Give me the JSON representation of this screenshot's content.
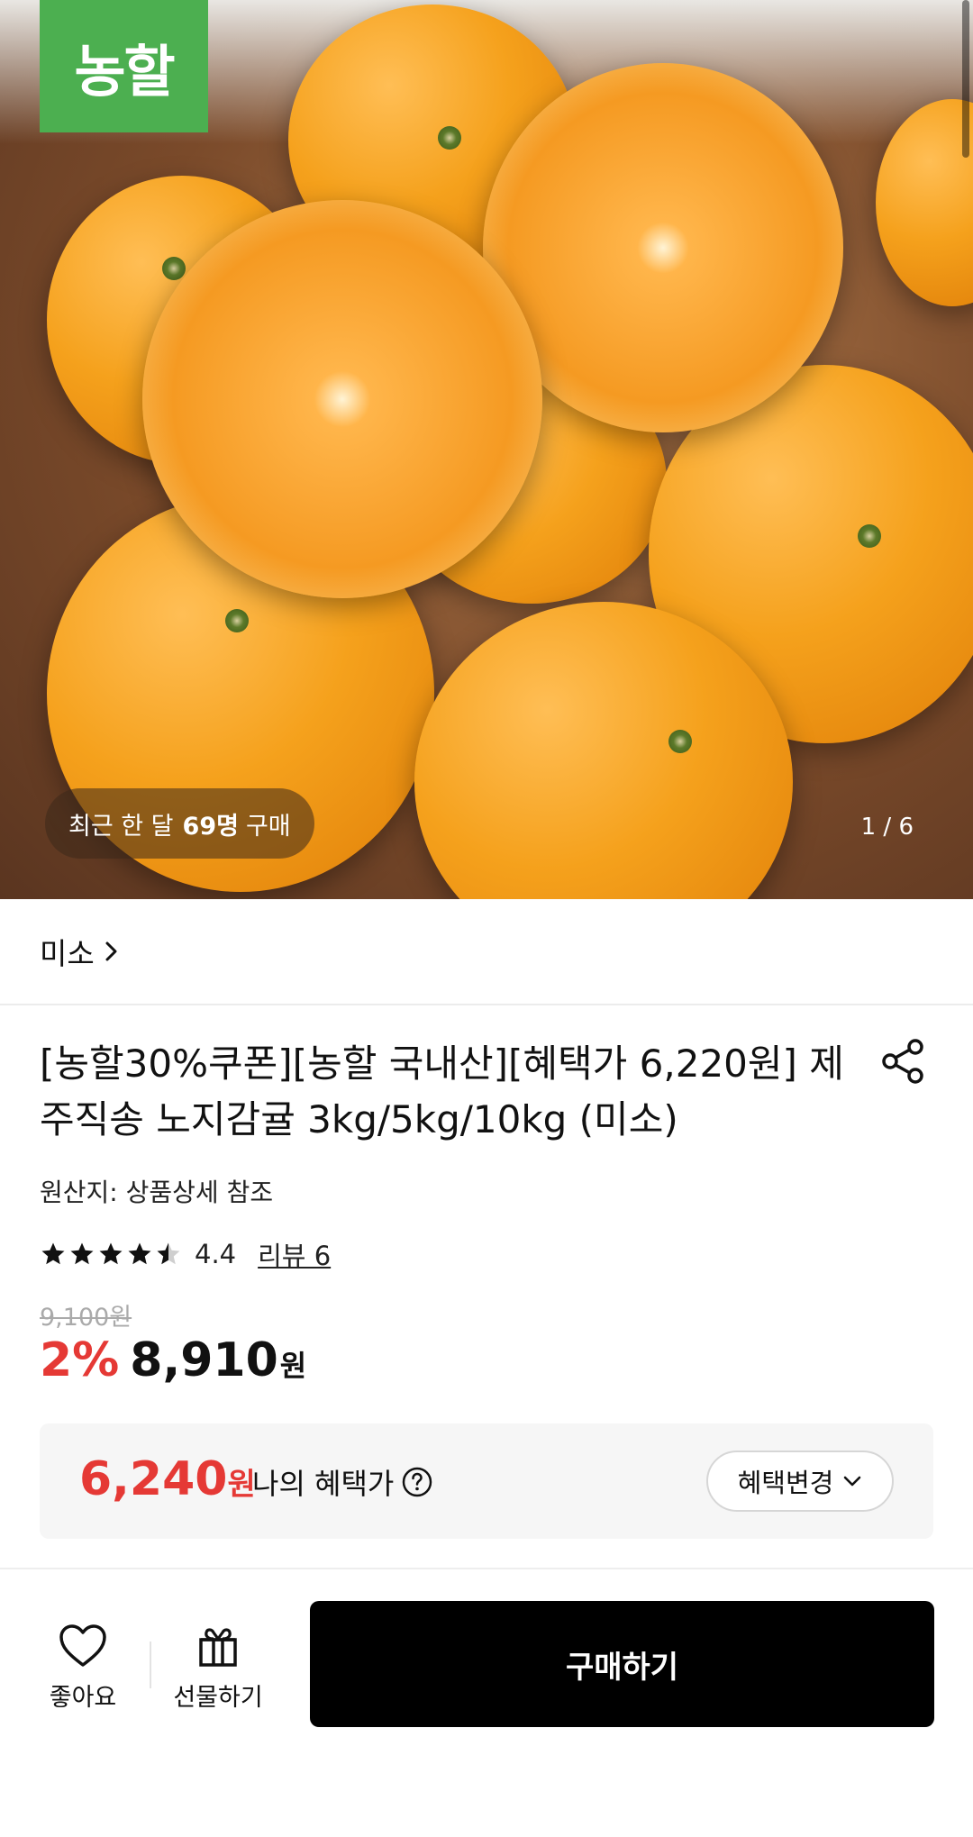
{
  "hero": {
    "brand_badge": "농할",
    "recent_purchase_prefix": "최근 한 달",
    "recent_purchase_count": "69명",
    "recent_purchase_suffix": "구매",
    "page_indicator": "1 / 6"
  },
  "seller": {
    "name": "미소",
    "chevron": "chevron-right-icon"
  },
  "product": {
    "title_line1": "[농할30%쿠폰][농할 국내산][혜택가 6,220원] 제",
    "title_line2": "주직송 노지감귤 3kg/5kg/10kg (미소)",
    "origin": "원산지: 상품상세 참조",
    "rating": 4.4,
    "rating_text": "4.4",
    "review_link": "리뷰 6",
    "original_price": "9,100원",
    "discount_rate": "2%",
    "price": "8,910",
    "price_unit": "원"
  },
  "benefit": {
    "price": "6,240",
    "price_unit": "원",
    "label": "나의 혜택가",
    "help_icon": "question-circle-icon",
    "change_button": "혜택변경",
    "change_icon": "chevron-down-icon"
  },
  "bottom_bar": {
    "like_label": "좋아요",
    "like_icon": "heart-icon",
    "gift_label": "선물하기",
    "gift_icon": "gift-icon",
    "buy_label": "구매하기"
  },
  "colors": {
    "brand_green": "#4caf50",
    "discount_red": "#e53935",
    "buy_button": "#000000"
  }
}
